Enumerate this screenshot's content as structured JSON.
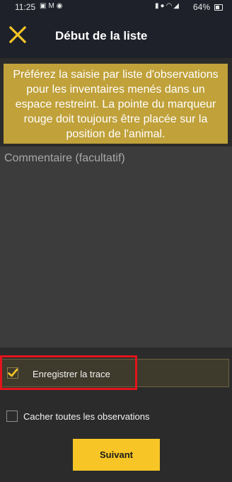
{
  "status_bar": {
    "time": "11:25",
    "battery": "64%",
    "left_icons": [
      "image-icon",
      "gmail-icon",
      "sync-icon"
    ],
    "right_icons": [
      "battery-saver-icon",
      "location-icon",
      "wifi-icon",
      "signal-icon"
    ]
  },
  "app_bar": {
    "title": "Début de la liste",
    "close_icon": "close-icon",
    "accent_color": "#f7c626"
  },
  "notice": {
    "text": "Préférez la saisie par liste d'observations pour les inventaires menés dans un espace restreint. La pointe du marqueur rouge doit toujours être placée sur la position de l'animal."
  },
  "comment": {
    "placeholder": "Commentaire (facultatif)",
    "value": ""
  },
  "options": {
    "record_trace": {
      "label": "Enregistrer la trace",
      "checked": true
    },
    "hide_observations": {
      "label": "Cacher toutes les observations",
      "checked": false
    }
  },
  "next_button": {
    "label": "Suivant"
  },
  "colors": {
    "highlight": "#e3141b",
    "notice_bg": "#c0a13a",
    "button_bg": "#f7c626"
  }
}
